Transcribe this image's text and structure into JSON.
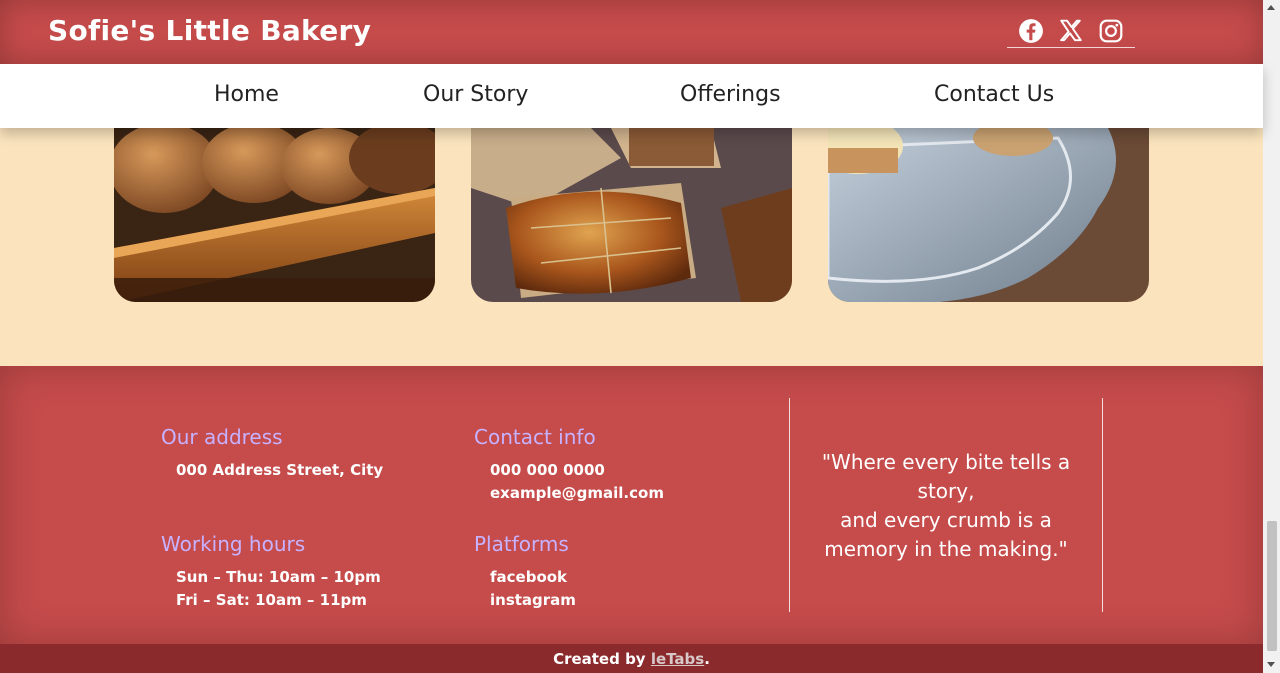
{
  "header": {
    "brand": "Sofie's Little Bakery",
    "socials": [
      "facebook-icon",
      "x-icon",
      "instagram-icon"
    ]
  },
  "nav": {
    "items": [
      "Home",
      "Our Story",
      "Offerings",
      "Contact Us"
    ]
  },
  "footer": {
    "address_heading": "Our address",
    "address_line": "000 Address Street, City",
    "hours_heading": "Working hours",
    "hours": [
      "Sun – Thu: 10am – 10pm",
      "Fri – Sat: 10am – 11pm"
    ],
    "contact_heading": "Contact info",
    "contact": [
      "000 000 0000",
      "example@gmail.com"
    ],
    "platforms_heading": "Platforms",
    "platforms": [
      "facebook",
      "instagram"
    ],
    "quote": "\"Where every bite tells a story,\nand every crumb is a memory in the making.\""
  },
  "credit": {
    "prefix": "Created by ",
    "link": "leTabs",
    "suffix": "."
  },
  "colors": {
    "header": "#c64b4b",
    "footer_credit": "#8b2a2c",
    "background": "#fbe4bd",
    "footer_heading": "#c7b2ff"
  }
}
